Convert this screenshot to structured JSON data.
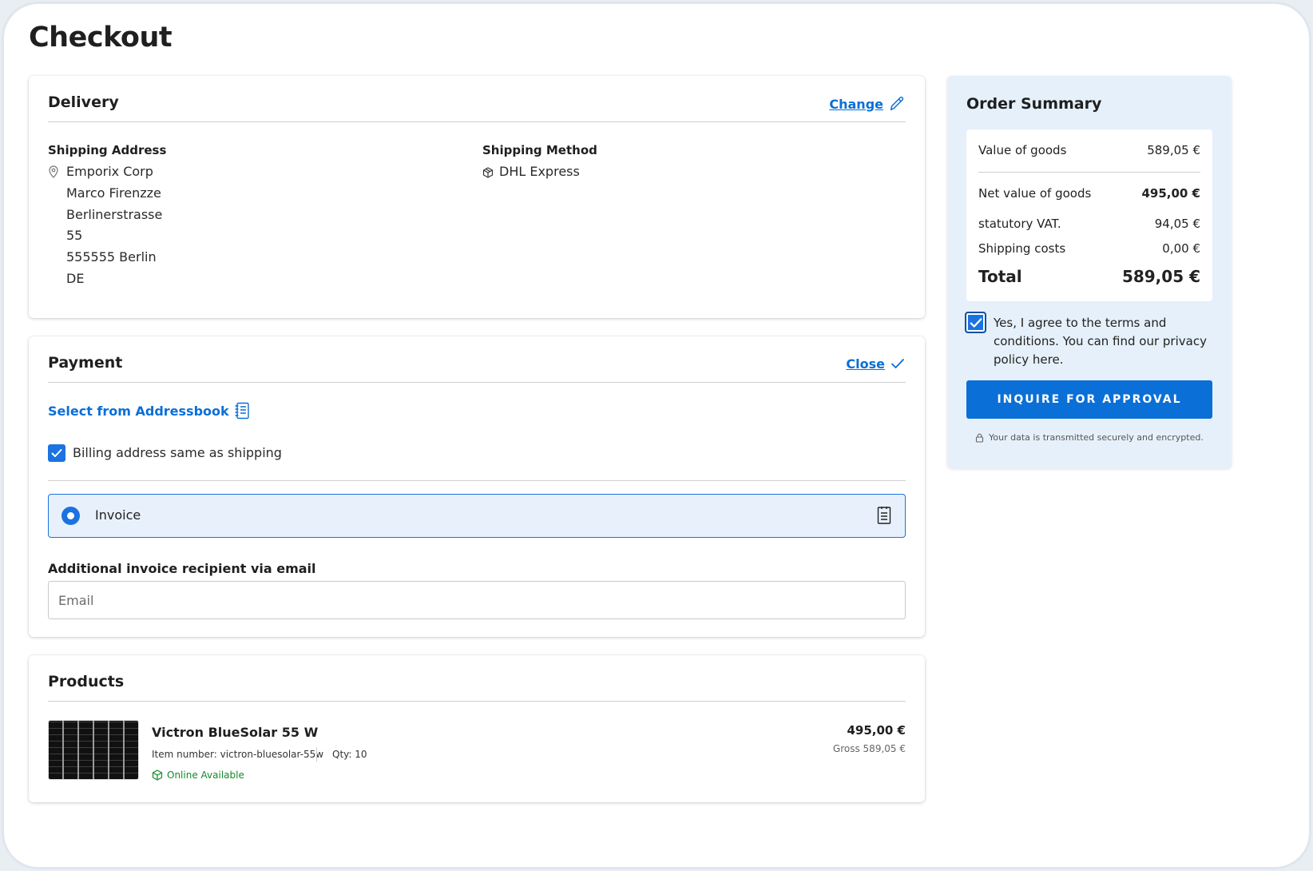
{
  "page": {
    "title": "Checkout"
  },
  "delivery": {
    "title": "Delivery",
    "change_label": "Change",
    "shipping_address_label": "Shipping Address",
    "address_lines": [
      "Emporix Corp",
      "Marco Firenzze",
      "Berlinerstrasse",
      "55",
      "555555 Berlin",
      "DE"
    ],
    "shipping_method_label": "Shipping Method",
    "shipping_method": "DHL Express"
  },
  "payment": {
    "title": "Payment",
    "close_label": "Close",
    "addressbook_label": "Select from Addressbook",
    "billing_same_label": "Billing address same as shipping",
    "billing_same_checked": true,
    "invoice_label": "Invoice",
    "additional_recipient_label": "Additional invoice recipient via email",
    "email_placeholder": "Email",
    "email_value": ""
  },
  "products": {
    "title": "Products",
    "items": [
      {
        "name": "Victron BlueSolar 55 W",
        "item_number": "Item number: victron-bluesolar-55w",
        "qty": "Qty: 10",
        "availability": "Online Available",
        "price": "495,00 €",
        "gross": "Gross 589,05 €"
      }
    ]
  },
  "summary": {
    "title": "Order Summary",
    "value_of_goods_label": "Value of goods",
    "value_of_goods": "589,05 €",
    "net_value_label": "Net value of goods",
    "net_value": "495,00 €",
    "vat_label": "statutory VAT.",
    "vat": "94,05 €",
    "shipping_label": "Shipping costs",
    "shipping": "0,00 €",
    "total_label": "Total",
    "total": "589,05 €",
    "terms_text": "Yes, I agree to the terms and conditions. You can find our privacy policy here.",
    "terms_checked": true,
    "approve_button": "INQUIRE FOR APPROVAL",
    "secure_note": "Your data is transmitted securely and encrypted."
  },
  "colors": {
    "accent": "#0a6fd6",
    "summary_bg": "#e6f0fa",
    "available_green": "#138a28"
  },
  "icons": [
    "pencil-icon",
    "map-pin-icon",
    "package-icon",
    "checkmark-icon",
    "addressbook-icon",
    "receipt-icon",
    "cube-icon",
    "lock-icon"
  ]
}
